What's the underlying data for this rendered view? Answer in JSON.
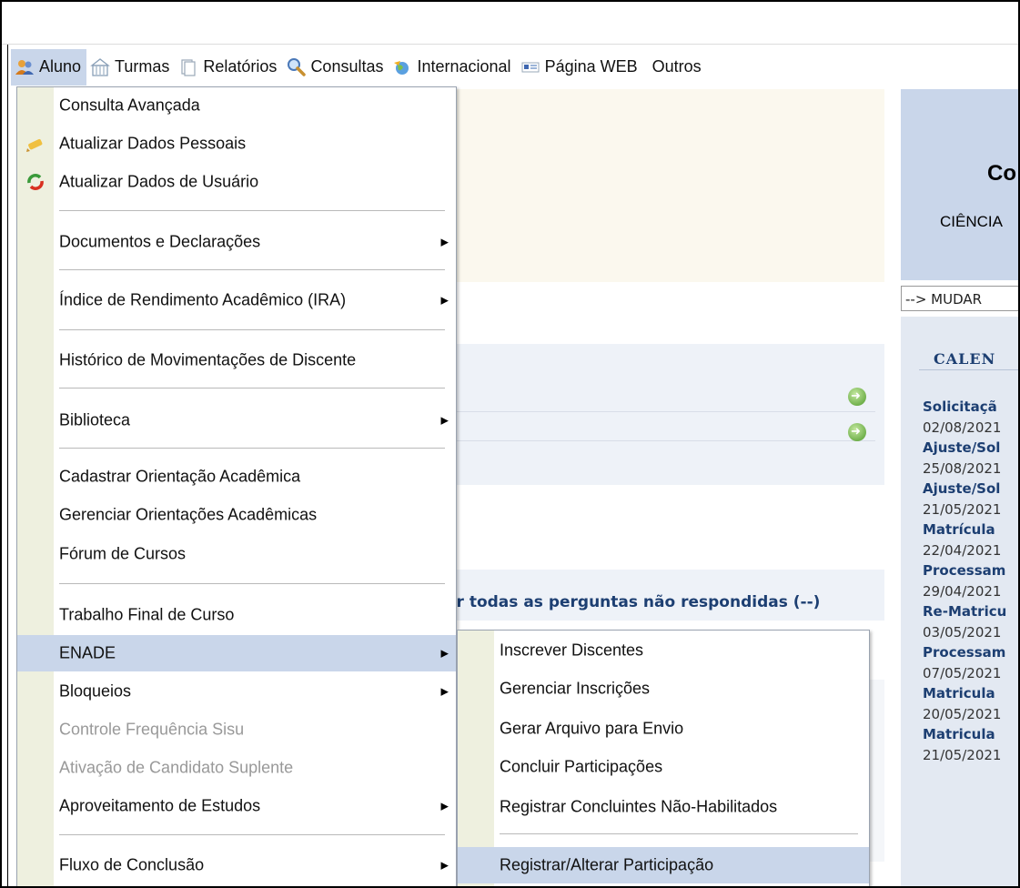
{
  "menubar": {
    "items": [
      {
        "label": "Aluno",
        "icon": "users-icon"
      },
      {
        "label": "Turmas",
        "icon": "building-icon"
      },
      {
        "label": "Relatórios",
        "icon": "document-icon"
      },
      {
        "label": "Consultas",
        "icon": "magnifier-icon"
      },
      {
        "label": "Internacional",
        "icon": "globe-icon"
      },
      {
        "label": "Página WEB",
        "icon": "webpage-icon"
      },
      {
        "label": "Outros",
        "icon": ""
      }
    ]
  },
  "aluno_menu": {
    "consulta_avancada": "Consulta Avançada",
    "atualizar_dados_pessoais": "Atualizar Dados Pessoais",
    "atualizar_dados_usuario": "Atualizar Dados de Usuário",
    "documentos_declaracoes": "Documentos e Declarações",
    "indice_rendimento": "Índice de Rendimento Acadêmico (IRA)",
    "historico_movimentacoes": "Histórico de Movimentações de Discente",
    "biblioteca": "Biblioteca",
    "cadastrar_orientacao": "Cadastrar Orientação Acadêmica",
    "gerenciar_orientacoes": "Gerenciar Orientações Acadêmicas",
    "forum_cursos": "Fórum de Cursos",
    "trabalho_final": "Trabalho Final de Curso",
    "enade": "ENADE",
    "bloqueios": "Bloqueios",
    "controle_frequencia": "Controle Frequência Sisu",
    "ativacao_candidato": "Ativação de Candidato Suplente",
    "aproveitamento_estudos": "Aproveitamento de Estudos",
    "fluxo_conclusao": "Fluxo de Conclusão"
  },
  "enade_menu": {
    "inscrever_discentes": "Inscrever Discentes",
    "gerenciar_inscricoes": "Gerenciar Inscrições",
    "gerar_arquivo": "Gerar Arquivo para Envio",
    "concluir_participacoes": "Concluir Participações",
    "registrar_concluintes": "Registrar Concluintes Não-Habilitados",
    "registrar_alterar": "Registrar/Alterar Participação"
  },
  "background": {
    "perguntas_link": "er todas as perguntas não respondidas (--)"
  },
  "right_panel": {
    "title_fragment": "Co",
    "course_fragment": "CIÊNCIA",
    "mudar": "--> MUDAR",
    "calendar_title": "CALEN",
    "calendar": [
      {
        "title": "Solicitaçã",
        "date": "02/08/2021"
      },
      {
        "title": "Ajuste/Sol",
        "date": "25/08/2021"
      },
      {
        "title": "Ajuste/Sol",
        "date": "21/05/2021"
      },
      {
        "title": "Matrícula",
        "date": "22/04/2021"
      },
      {
        "title": "Processam",
        "date": "29/04/2021"
      },
      {
        "title": "Re-Matricu",
        "date": "03/05/2021"
      },
      {
        "title": "Processam",
        "date": "07/05/2021"
      },
      {
        "title": "Matricula",
        "date": "20/05/2021"
      },
      {
        "title": "Matricula",
        "date": "21/05/2021"
      }
    ]
  },
  "colors": {
    "highlight": "#c9d6ea",
    "menu_gutter": "#eef0df",
    "link_blue": "#1d3f72",
    "disabled": "#999999"
  }
}
